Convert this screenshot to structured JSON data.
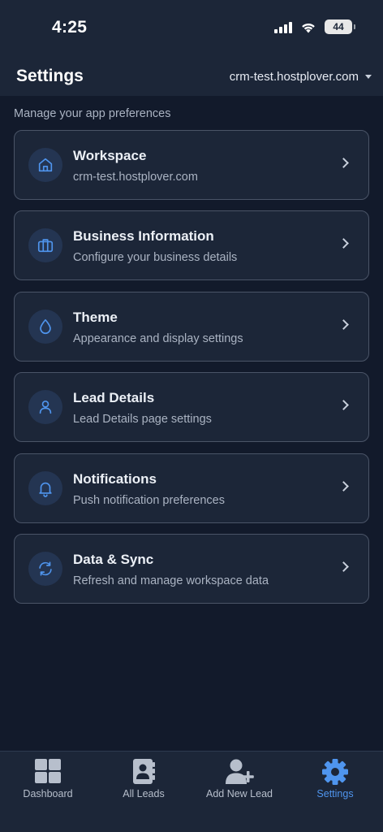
{
  "status_bar": {
    "time": "4:25",
    "battery": "44"
  },
  "header": {
    "title": "Settings",
    "workspace": "crm-test.hostplover.com"
  },
  "subtitle": "Manage your app preferences",
  "cards": [
    {
      "title": "Workspace",
      "subtitle": "crm-test.hostplover.com",
      "icon": "home-icon"
    },
    {
      "title": "Business Information",
      "subtitle": "Configure your business details",
      "icon": "briefcase-icon"
    },
    {
      "title": "Theme",
      "subtitle": "Appearance and display settings",
      "icon": "droplet-icon"
    },
    {
      "title": "Lead Details",
      "subtitle": "Lead Details page settings",
      "icon": "user-icon"
    },
    {
      "title": "Notifications",
      "subtitle": "Push notification preferences",
      "icon": "bell-icon"
    },
    {
      "title": "Data & Sync",
      "subtitle": "Refresh and manage workspace data",
      "icon": "refresh-icon"
    }
  ],
  "tabs": [
    {
      "label": "Dashboard",
      "icon": "dashboard-icon",
      "active": false
    },
    {
      "label": "All Leads",
      "icon": "contacts-icon",
      "active": false
    },
    {
      "label": "Add New Lead",
      "icon": "add-user-icon",
      "active": false
    },
    {
      "label": "Settings",
      "icon": "gear-icon",
      "active": true
    }
  ],
  "colors": {
    "background": "#121a2b",
    "surface": "#1c2638",
    "accent": "#4f95ee",
    "card_border": "#4a5467"
  }
}
